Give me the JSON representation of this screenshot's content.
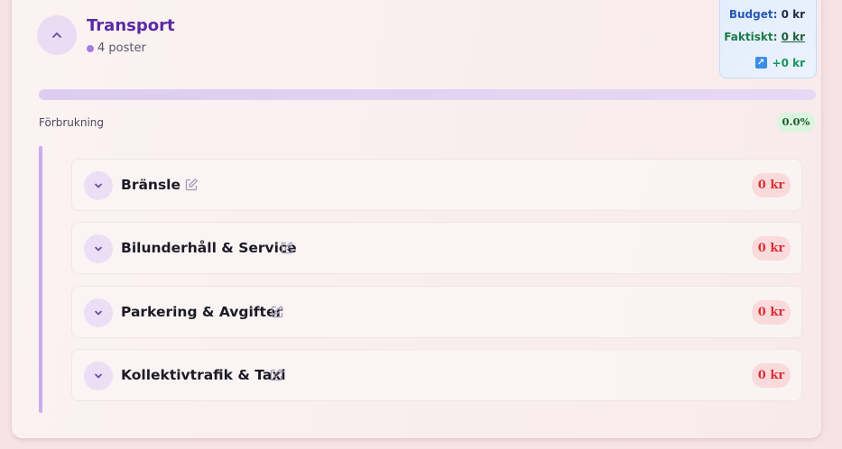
{
  "category": {
    "title": "Transport",
    "count_label": "4 poster",
    "collapse_icon": "chevron-up-icon"
  },
  "budget": {
    "budget_label": "Budget:",
    "budget_value": "0 kr",
    "actual_label": "Faktiskt:",
    "actual_value": "0 kr",
    "trend_icon": "trend-up-icon",
    "trend_value": "+0 kr"
  },
  "usage": {
    "label": "Förbrukning",
    "percent": "0.0%",
    "progress_fraction": 0.0
  },
  "items": [
    {
      "label": "Bränsle",
      "amount": "0 kr"
    },
    {
      "label": "Bilunderhåll & Service",
      "amount": "0 kr"
    },
    {
      "label": "Parkering & Avgifter",
      "amount": "0 kr"
    },
    {
      "label": "Kollektivtrafik & Taxi",
      "amount": "0 kr"
    }
  ],
  "colors": {
    "accent": "#5b2aa3",
    "budget": "#2857b5",
    "actual": "#1c7a4a",
    "negative": "#d72f38"
  }
}
